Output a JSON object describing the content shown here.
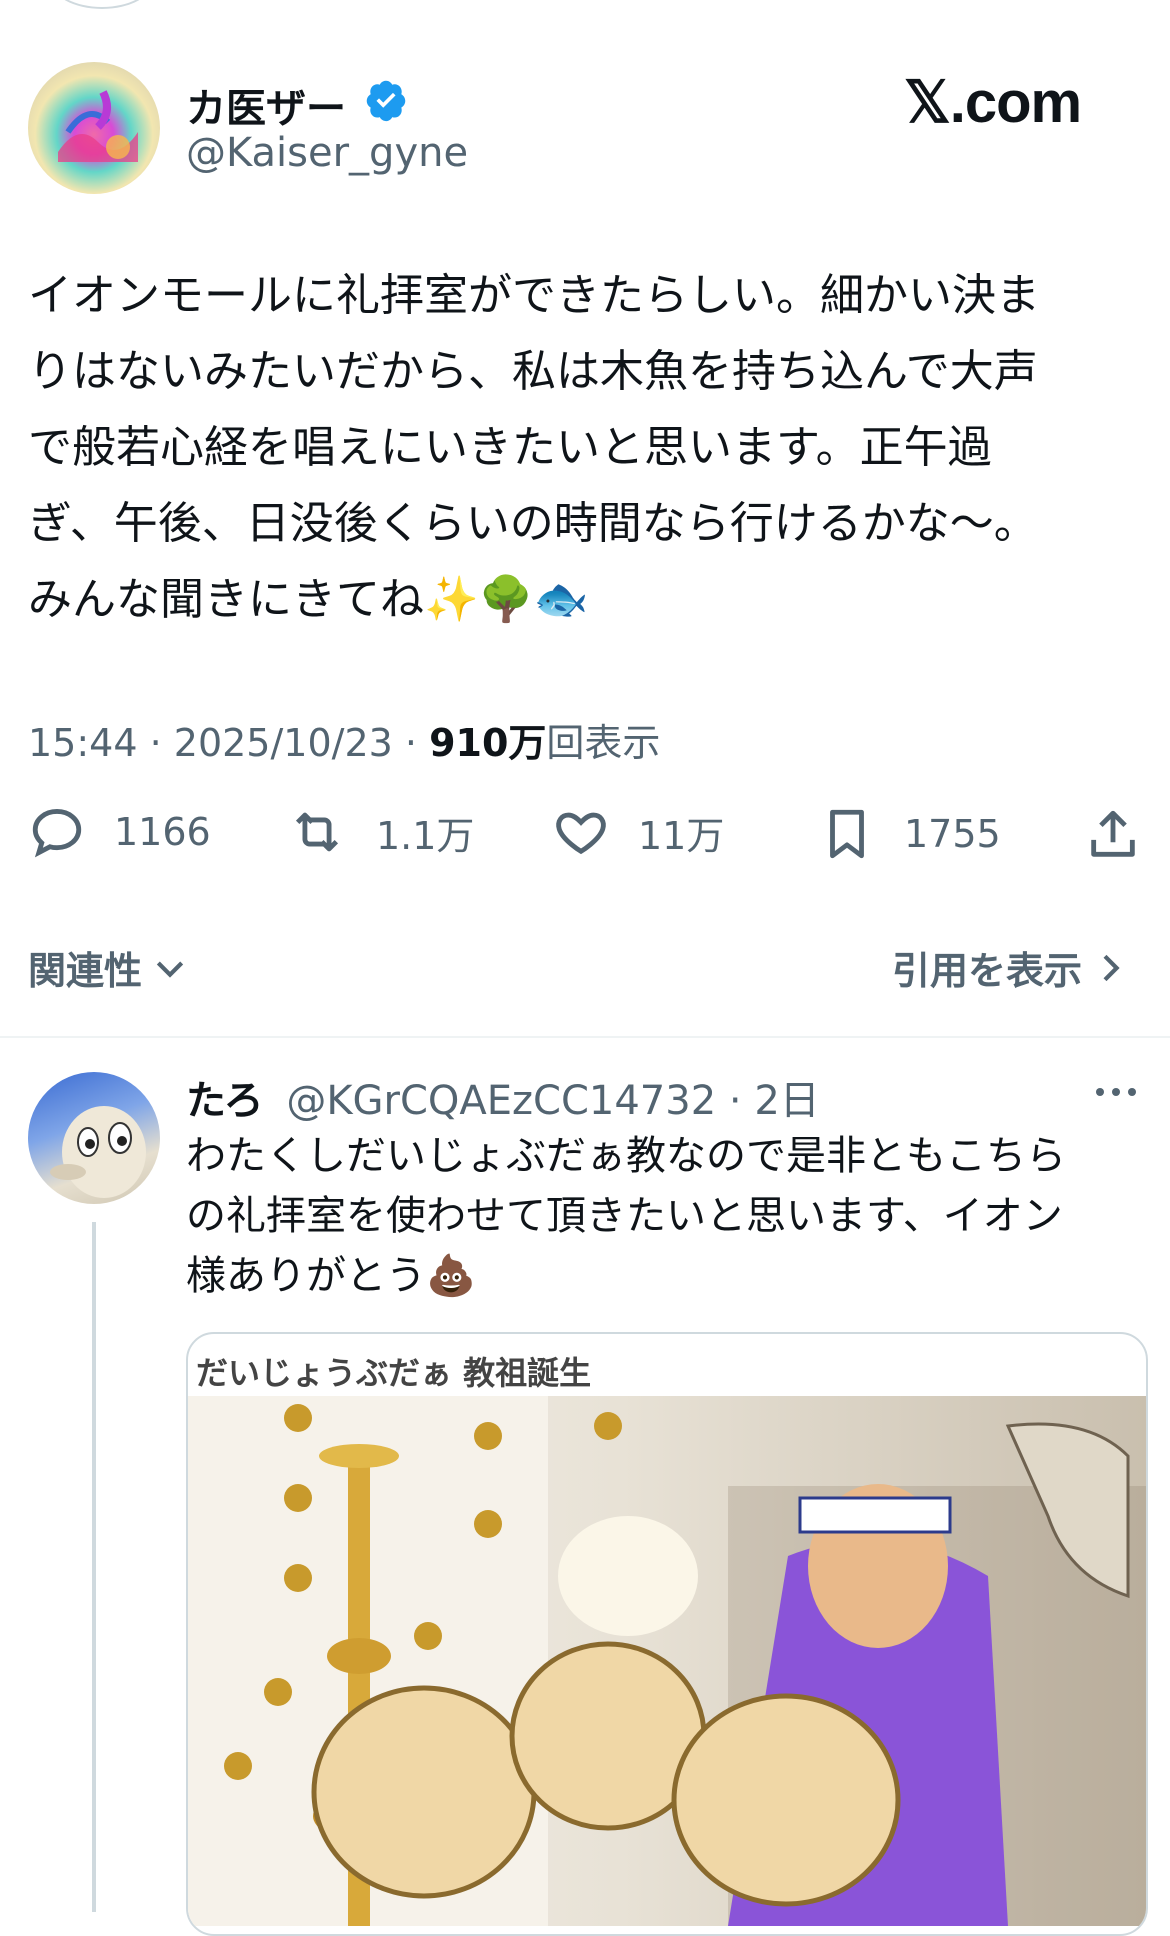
{
  "tweet": {
    "author_name": "カ医ザー",
    "author_handle": "@Kaiser_gyne",
    "site_logo": "𝕏.com",
    "text": "イオンモールに礼拝室ができたらしい。細かい決ま\nりはないみたいだから、私は木魚を持ち込んで大声\nで般若心経を唱えにいきたいと思います。正午過\nぎ、午後、日没後くらいの時間なら行けるかな〜。\nみんな聞きにきてね✨🌳🐟",
    "time": "15:44",
    "date": "2025/10/23",
    "views_count": "910万",
    "views_label": "回表示",
    "replies": "1166",
    "retweets": "1.1万",
    "likes": "11万",
    "bookmarks": "1755",
    "icons": [
      "verified-badge-icon",
      "reply-icon",
      "retweet-icon",
      "like-icon",
      "bookmark-icon",
      "share-icon"
    ]
  },
  "sort": {
    "label": "関連性",
    "quotes_label": "引用を表示"
  },
  "reply": {
    "author_name": "たろ",
    "author_handle": "@KGrCQAEzCC14732",
    "age": "2日",
    "text": "わたくしだいじょぶだぁ教なので是非ともこちら\nの礼拝室を使わせて頂きたいと思います、イオン\n様ありがとう💩",
    "media_caption": "だいじょうぶだぁ 教祖誕生"
  },
  "colors": {
    "text": "#0f1419",
    "secondary": "#536471",
    "verified": "#1d9bf0",
    "divider": "#eff3f4"
  }
}
